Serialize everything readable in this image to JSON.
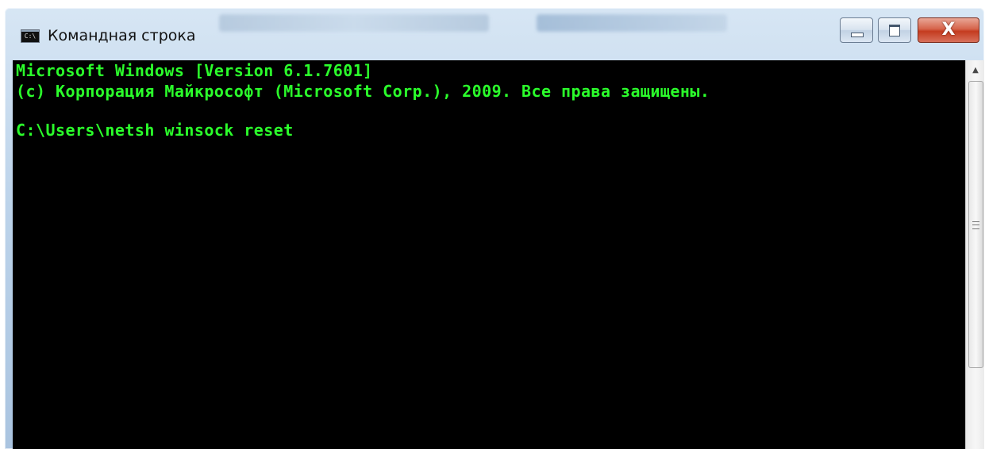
{
  "window": {
    "title": "Командная строка",
    "icon_name": "command-prompt-icon",
    "icon_text": "C:\\"
  },
  "controls": {
    "minimize_icon": "minimize-icon",
    "maximize_icon": "maximize-icon",
    "close_icon": "close-icon",
    "close_label": "X"
  },
  "console": {
    "lines": [
      "Microsoft Windows [Version 6.1.7601]",
      "(c) Корпорация Майкрософт (Microsoft Corp.), 2009. Все права защищены.",
      "C:\\Users\\netsh winsock reset"
    ],
    "text_color": "#2bff2b",
    "background_color": "#000000"
  },
  "scrollbar": {
    "up_arrow_icon": "scroll-up-arrow-icon",
    "up_arrow_glyph": "▲"
  }
}
